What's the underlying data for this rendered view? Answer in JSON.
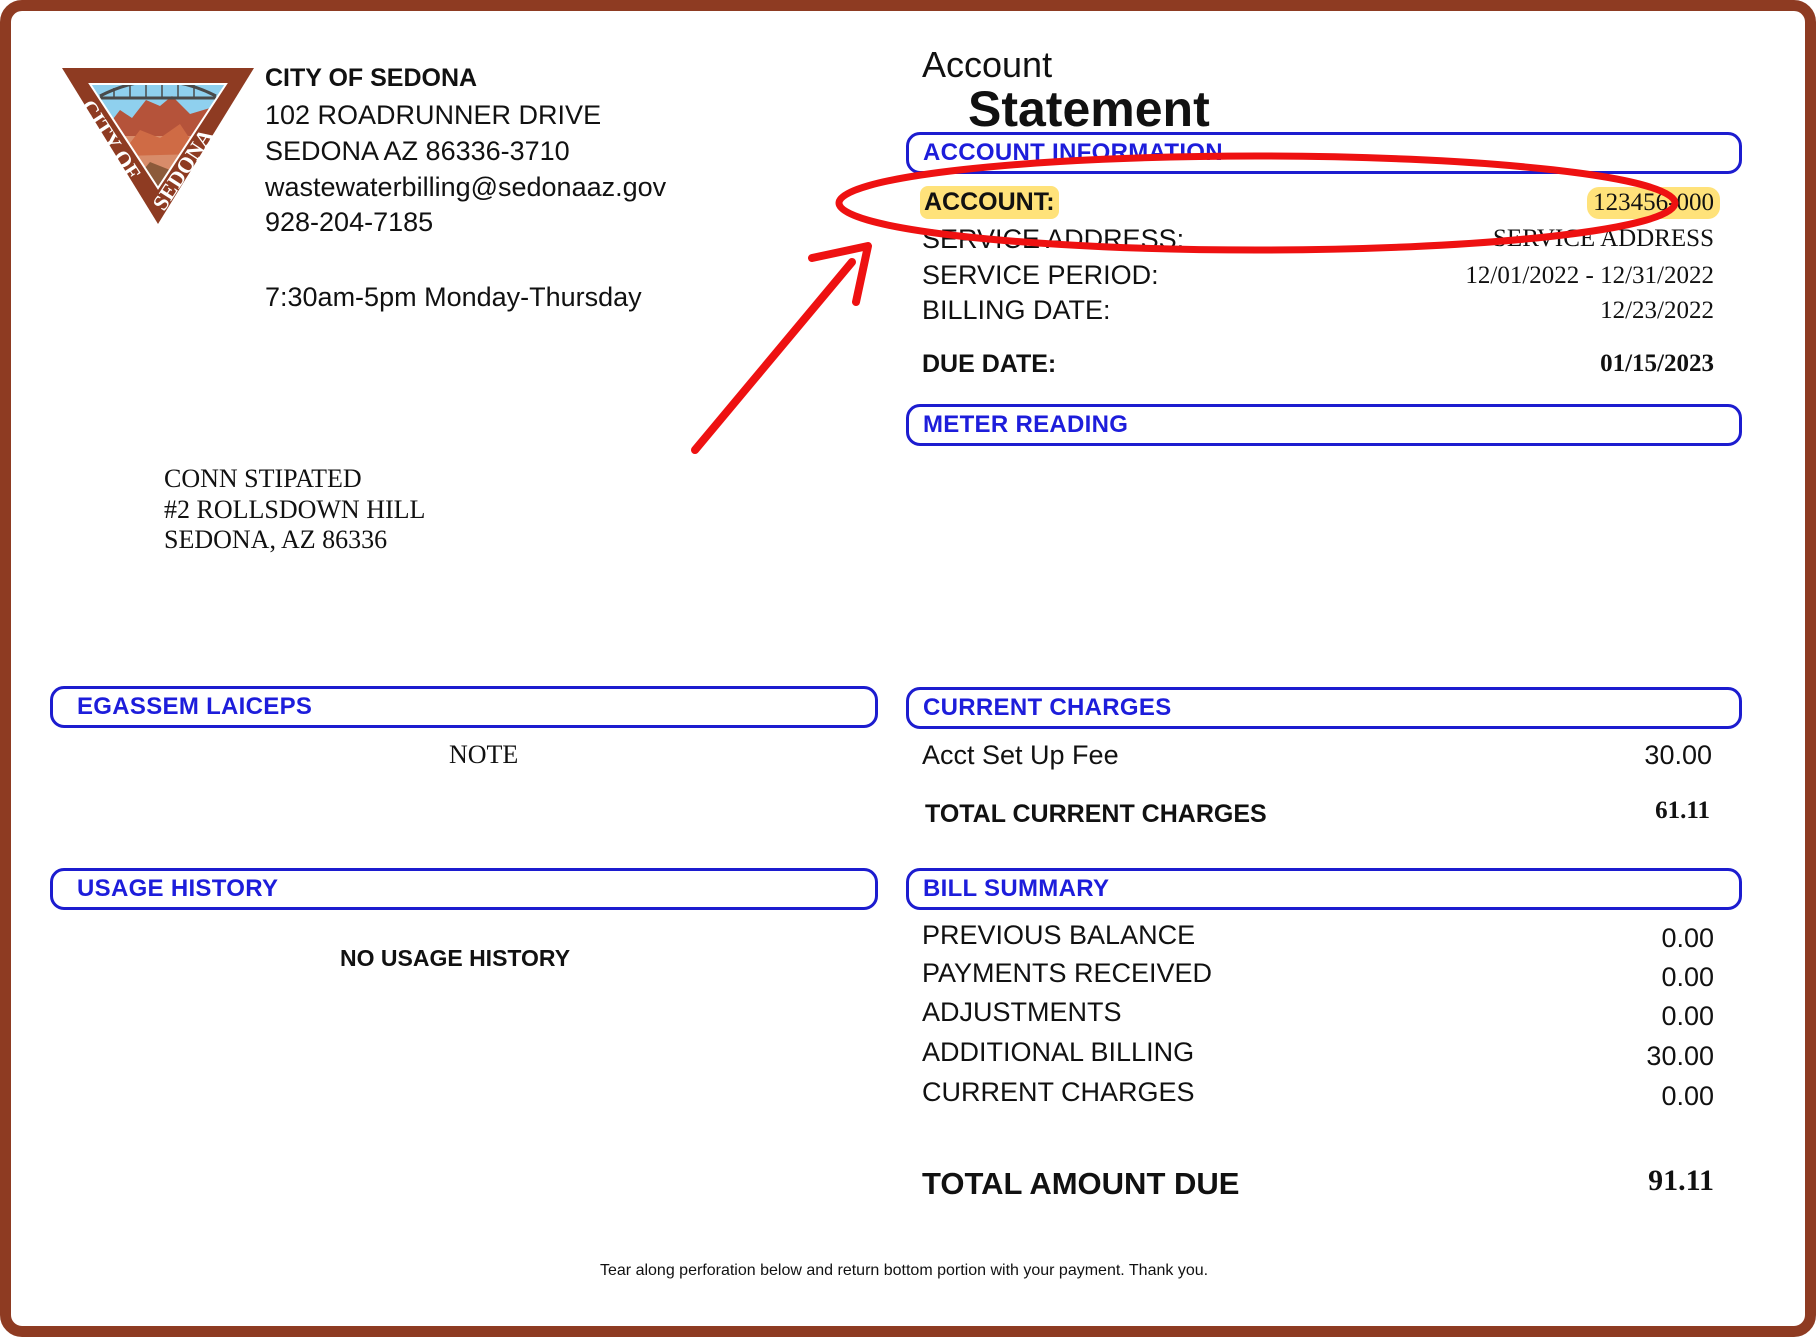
{
  "header": {
    "org_name": "CITY OF SEDONA",
    "address_line1": "102 ROADRUNNER DRIVE",
    "address_line2": "SEDONA AZ 86336-3710",
    "email": "wastewaterbilling@sedonaaz.gov",
    "phone": "928-204-7185",
    "hours": "7:30am-5pm Monday-Thursday",
    "logo_text": "CITY OF SEDONA"
  },
  "title": {
    "line1": "Account",
    "line2": "Statement"
  },
  "account_info": {
    "section_label": "ACCOUNT INFORMATION",
    "account_label": "ACCOUNT:",
    "account_value": "123456-000",
    "service_address_label": "SERVICE ADDRESS:",
    "service_address_value": "SERVICE ADDRESS",
    "service_period_label": "SERVICE PERIOD:",
    "service_period_value": "12/01/2022 - 12/31/2022",
    "billing_date_label": "BILLING DATE:",
    "billing_date_value": "12/23/2022",
    "due_date_label": "DUE DATE:",
    "due_date_value": "01/15/2023"
  },
  "meter_reading": {
    "section_label": "METER READING"
  },
  "mailing": {
    "name": "CONN STIPATED",
    "street": "#2 ROLLSDOWN HILL",
    "city": "SEDONA, AZ 86336"
  },
  "special_message": {
    "section_label": "EGASSEM LAICEPS",
    "note": "NOTE"
  },
  "current_charges": {
    "section_label": "CURRENT CHARGES",
    "items": [
      {
        "label": "Acct Set Up Fee",
        "amount": "30.00"
      }
    ],
    "total_label": "TOTAL CURRENT CHARGES",
    "total_value": "61.11"
  },
  "usage_history": {
    "section_label": "USAGE HISTORY",
    "empty_text": "NO USAGE HISTORY"
  },
  "bill_summary": {
    "section_label": "BILL SUMMARY",
    "rows": [
      {
        "label": "PREVIOUS BALANCE",
        "amount": "0.00"
      },
      {
        "label": "PAYMENTS RECEIVED",
        "amount": "0.00"
      },
      {
        "label": "ADJUSTMENTS",
        "amount": "0.00"
      },
      {
        "label": "ADDITIONAL BILLING",
        "amount": "30.00"
      },
      {
        "label": "CURRENT CHARGES",
        "amount": "0.00"
      }
    ],
    "total_label": "TOTAL AMOUNT DUE",
    "total_value": "91.11"
  },
  "footer": {
    "tear_note": "Tear along perforation below and return bottom portion with your payment.  Thank you."
  },
  "colors": {
    "frame": "#8e3b22",
    "section_blue": "#1d1ddb",
    "highlight": "#ffe27a",
    "annotation_red": "#ee1111"
  }
}
